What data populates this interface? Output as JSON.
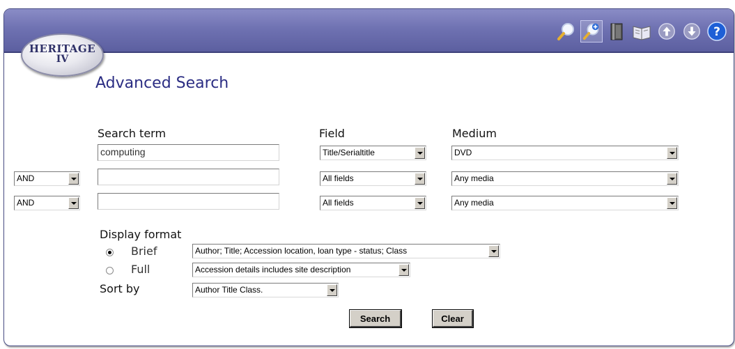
{
  "app": {
    "logo_line1": "HERITAGE",
    "logo_line2": "IV"
  },
  "toolbar": {
    "buttons": [
      {
        "icon": "magnifier-icon"
      },
      {
        "icon": "magnifier-plus-icon"
      },
      {
        "icon": "book-icon"
      },
      {
        "icon": "open-book-icon"
      },
      {
        "icon": "arrow-up-icon"
      },
      {
        "icon": "arrow-down-icon"
      },
      {
        "icon": "help-icon"
      }
    ]
  },
  "page": {
    "title": "Advanced Search"
  },
  "columns": {
    "search_term": "Search term",
    "field": "Field",
    "medium": "Medium"
  },
  "rows": [
    {
      "term": "computing",
      "field": "Title/Serialtitle",
      "medium": "DVD"
    },
    {
      "operator": "AND",
      "term": "",
      "field": "All fields",
      "medium": "Any media"
    },
    {
      "operator": "AND",
      "term": "",
      "field": "All fields",
      "medium": "Any media"
    }
  ],
  "display": {
    "label": "Display format",
    "brief_label": "Brief",
    "brief_value": "Author; Title; Accession location, loan type - status; Class",
    "full_label": "Full",
    "full_value": "Accession details includes site description",
    "selected": "Brief"
  },
  "sort": {
    "label": "Sort by",
    "value": "Author Title Class."
  },
  "actions": {
    "search": "Search",
    "clear": "Clear"
  },
  "colors": {
    "toolbar": "#6f72b2",
    "heading": "#2b2d83"
  }
}
